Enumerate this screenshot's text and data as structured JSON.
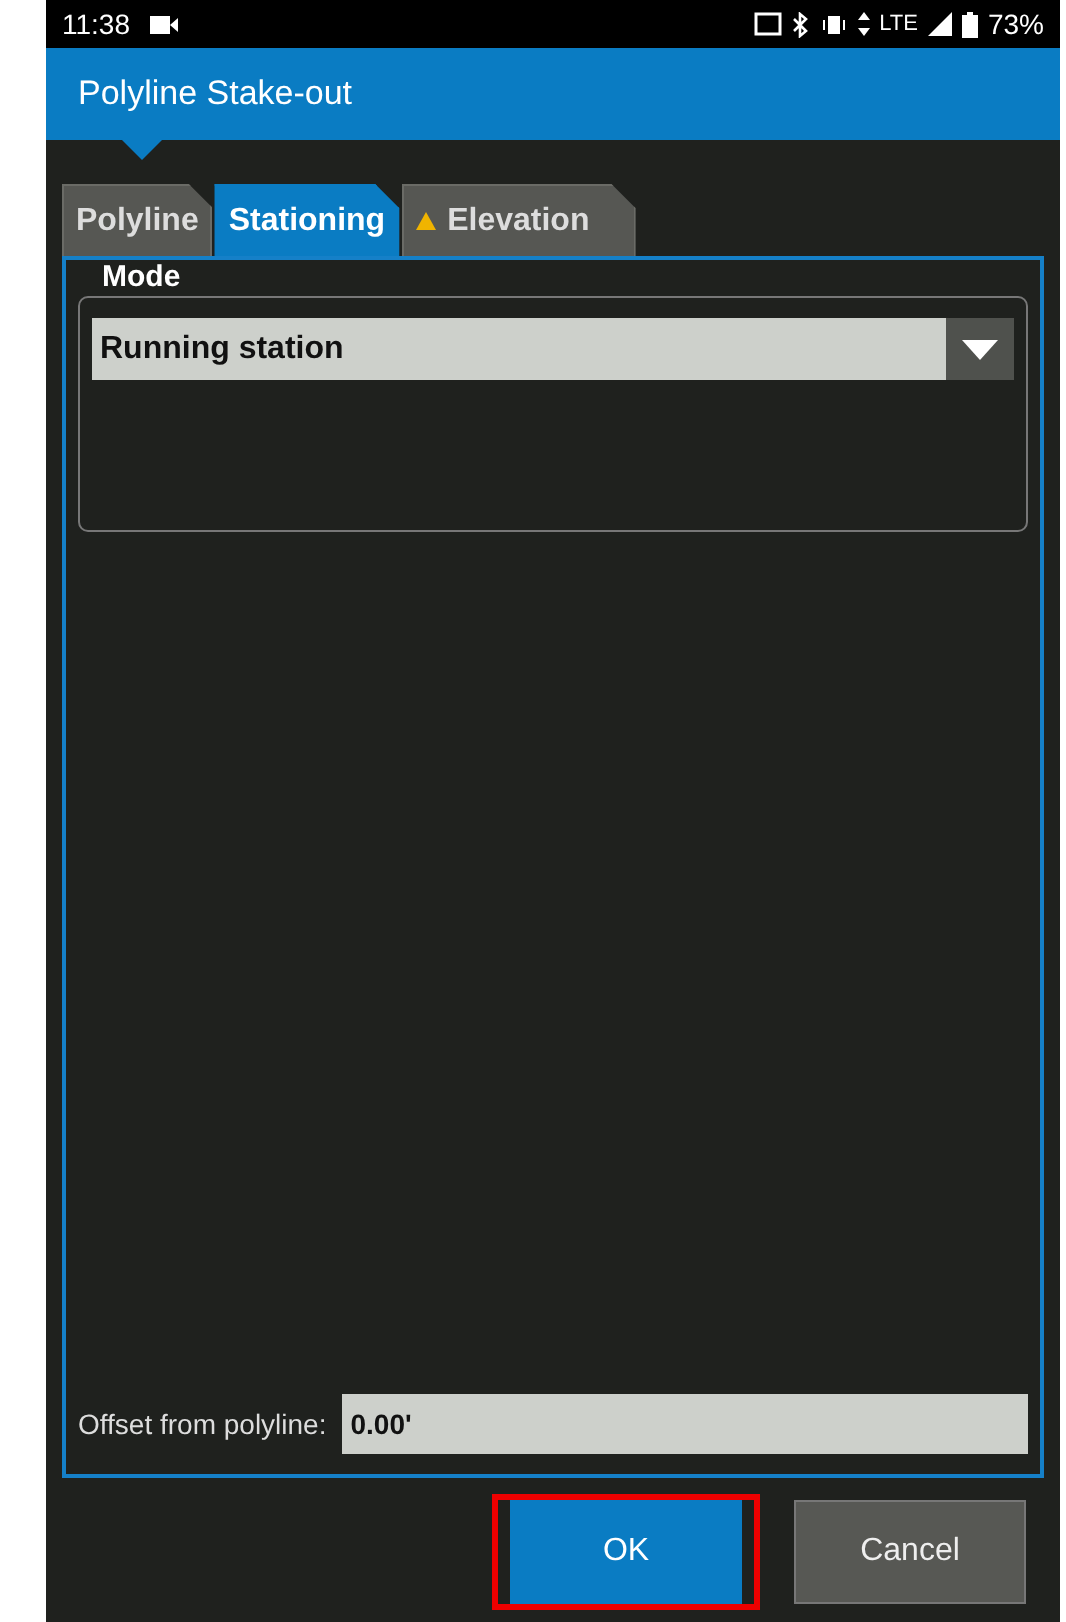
{
  "status_bar": {
    "time": "11:38",
    "battery": "73%",
    "network": "LTE"
  },
  "header": {
    "title": "Polyline Stake-out"
  },
  "tabs": [
    {
      "label": "Polyline",
      "selected": false,
      "warning": false
    },
    {
      "label": "Stationing",
      "selected": true,
      "warning": false
    },
    {
      "label": "Elevation",
      "selected": false,
      "warning": true
    }
  ],
  "mode_group": {
    "title": "Mode",
    "dropdown": {
      "value": "Running station"
    }
  },
  "offset": {
    "label": "Offset from polyline:",
    "value": "0.00'"
  },
  "buttons": [
    {
      "label": "OK",
      "kind": "primary",
      "highlighted": true
    },
    {
      "label": "Cancel",
      "kind": "secondary",
      "highlighted": false
    }
  ]
}
